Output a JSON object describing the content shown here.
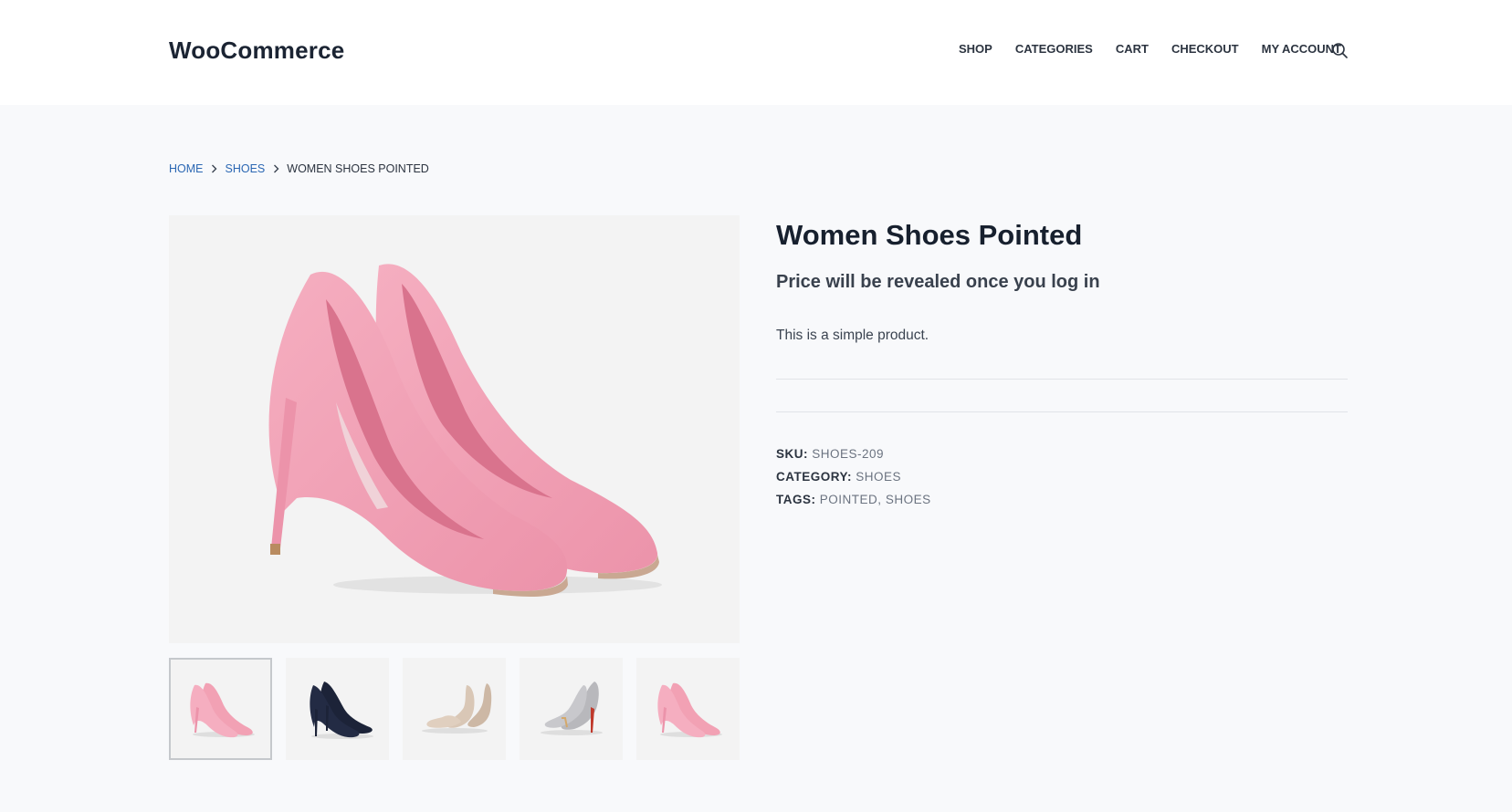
{
  "header": {
    "logo": "WooCommerce",
    "nav": [
      "SHOP",
      "CATEGORIES",
      "CART",
      "CHECKOUT",
      "MY ACCOUNT"
    ],
    "search_icon": "search-icon"
  },
  "breadcrumb": {
    "home": "HOME",
    "category": "SHOES",
    "current": "WOMEN SHOES POINTED"
  },
  "product": {
    "title": "Women Shoes Pointed",
    "price_note": "Price will be revealed once you log in",
    "description": "This is a simple product.",
    "sku_label": "SKU:",
    "sku_value": "SHOES-209",
    "category_label": "CATEGORY:",
    "category_value": "SHOES",
    "tags_label": "TAGS:",
    "tags": [
      "POINTED",
      "SHOES"
    ],
    "tag_separator": ","
  },
  "colors": {
    "pink": "#f2a1b4",
    "navy": "#1c2338",
    "nude": "#d9c7b6",
    "silver": "#b8b8bc",
    "link": "#2b67b3"
  }
}
